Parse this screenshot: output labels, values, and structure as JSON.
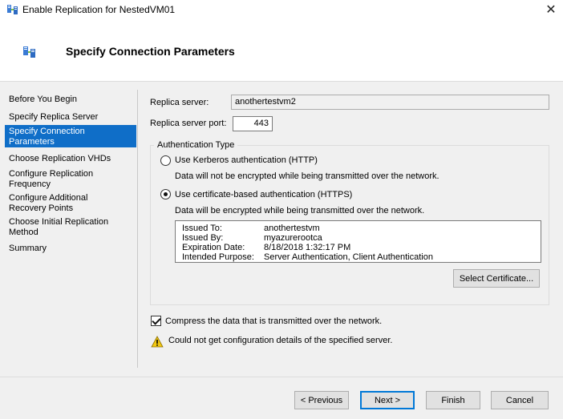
{
  "window": {
    "title": "Enable Replication for NestedVM01",
    "close_glyph": "✕"
  },
  "header": {
    "title": "Specify Connection Parameters"
  },
  "nav": {
    "items": [
      {
        "label": "Before You Begin"
      },
      {
        "label": "Specify Replica Server"
      },
      {
        "label": "Specify Connection Parameters",
        "active": true
      },
      {
        "label": "Choose Replication VHDs"
      },
      {
        "label": "Configure Replication Frequency"
      },
      {
        "label": "Configure Additional Recovery Points"
      },
      {
        "label": "Choose Initial Replication Method"
      },
      {
        "label": "Summary"
      }
    ]
  },
  "form": {
    "replica_server_label": "Replica server:",
    "replica_server_value": "anothertestvm2",
    "replica_port_label": "Replica server port:",
    "replica_port_value": "443",
    "auth_group_label": "Authentication Type",
    "kerberos_label": "Use Kerberos authentication (HTTP)",
    "kerberos_desc": "Data will not be encrypted while being transmitted over the network.",
    "cert_label": "Use certificate-based authentication (HTTPS)",
    "cert_desc": "Data will be encrypted while being transmitted over the network.",
    "certificate": {
      "issued_to_label": "Issued To:",
      "issued_to_value": "anothertestvm",
      "issued_by_label": "Issued By:",
      "issued_by_value": "myazurerootca",
      "expiration_label": "Expiration Date:",
      "expiration_value": "8/18/2018 1:32:17 PM",
      "purpose_label": "Intended Purpose:",
      "purpose_value": "Server Authentication, Client Authentication"
    },
    "select_cert_button": "Select Certificate...",
    "compress_label": "Compress the data that is transmitted over the network.",
    "compress_checked": true,
    "warning_text": "Could not get configuration details of the specified server."
  },
  "footer": {
    "previous_button": "< Previous",
    "next_button": "Next >",
    "finish_button": "Finish",
    "cancel_button": "Cancel"
  },
  "colors": {
    "nav_active_bg": "#0f6ec8",
    "warning_yellow": "#f2c811"
  }
}
